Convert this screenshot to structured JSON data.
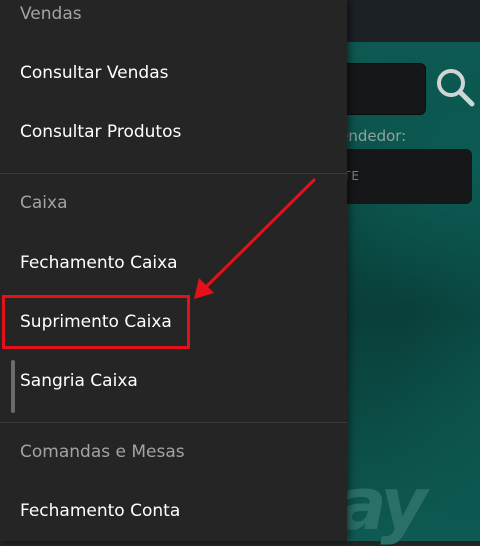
{
  "drawer": {
    "sections": [
      {
        "title": "Vendas",
        "items": [
          "Consultar Vendas",
          "Consultar Produtos"
        ]
      },
      {
        "title": "Caixa",
        "items": [
          "Fechamento Caixa",
          "Suprimento Caixa",
          "Sangria Caixa"
        ]
      },
      {
        "title": "Comandas e Mesas",
        "items": [
          "Fechamento Conta"
        ]
      }
    ]
  },
  "background": {
    "vendor_label": "Vendedor:",
    "vendor_value": "TE",
    "watermark": "ay"
  },
  "annotation": {
    "color": "#e4101a",
    "highlighted_item": "Suprimento Caixa"
  },
  "colors": {
    "drawer_bg": "#252525",
    "accent_teal": "#0e5a52"
  }
}
